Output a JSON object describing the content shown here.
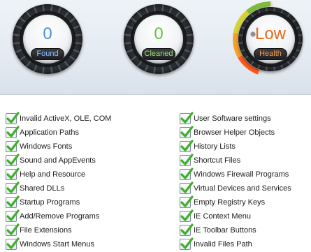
{
  "gauges": {
    "found": {
      "value": "0",
      "label": "Found"
    },
    "cleaned": {
      "value": "0",
      "label": "Cleaned"
    },
    "health": {
      "value": "Low",
      "label": "Health"
    }
  },
  "scan_items_left": [
    "Invalid ActiveX, OLE, COM",
    "Application Paths",
    "Windows Fonts",
    "Sound and AppEvents",
    "Help and Resource",
    "Shared DLLs",
    "Startup Programs",
    "Add/Remove Programs",
    "File Extensions",
    "Windows Start Menus"
  ],
  "scan_items_right": [
    "User Software settings",
    "Browser Helper Objects",
    "History Lists",
    "Shortcut Files",
    "Windows Firewall Programs",
    "Virtual Devices and Services",
    "Empty Registry Keys",
    "IE Context Menu",
    "IE Toolbar Buttons",
    "Invalid Files Path"
  ],
  "colors": {
    "found": "#4a8fd8",
    "cleaned": "#66c23a",
    "health": "#e66a1a",
    "check": "#3fae2a"
  }
}
